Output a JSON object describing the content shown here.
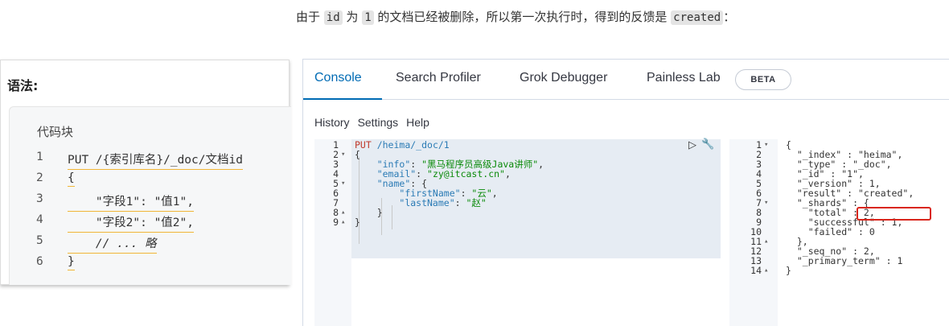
{
  "top_text": {
    "part1": "由于 ",
    "code1": "id",
    "part2": " 为 ",
    "code2": "1",
    "part3": " 的文档已经被删除，所以第一次执行时，得到的反馈是 ",
    "code3": "created",
    "part4": "："
  },
  "syntax": {
    "title": "语法:",
    "block_title": "代码块",
    "lines": [
      {
        "no": "1",
        "text": "PUT /{索引库名}/_doc/文档id"
      },
      {
        "no": "2",
        "text": "{"
      },
      {
        "no": "3",
        "text": "    \"字段1\": \"值1\","
      },
      {
        "no": "4",
        "text": "    \"字段2\": \"值2\","
      },
      {
        "no": "5",
        "text": "    // ... 略"
      },
      {
        "no": "6",
        "text": "}"
      }
    ]
  },
  "console": {
    "tabs": [
      "Console",
      "Search Profiler",
      "Grok Debugger",
      "Painless Lab"
    ],
    "active_tab": "Console",
    "beta_label": "BETA",
    "toolbar": [
      "History",
      "Settings",
      "Help"
    ],
    "request": {
      "method": "PUT",
      "path": " /heima/_doc/1",
      "line_numbers": [
        "1",
        "2",
        "3",
        "4",
        "5",
        "6",
        "7",
        "8",
        "9"
      ],
      "info_key": "\"info\"",
      "info_val": "\"黑马程序员高级Java讲师\"",
      "email_key": "\"email\"",
      "email_val": "\"zy@itcast.cn\"",
      "name_key": "\"name\"",
      "first_key": "\"firstName\"",
      "first_val": "\"云\"",
      "last_key": "\"lastName\"",
      "last_val": "\"赵\""
    },
    "response": {
      "line_numbers": [
        "1",
        "2",
        "3",
        "4",
        "5",
        "6",
        "7",
        "8",
        "9",
        "10",
        "11",
        "12",
        "13",
        "14"
      ],
      "lines": [
        "{",
        "  \"_index\" : \"heima\",",
        "  \"_type\" : \"_doc\",",
        "  \"_id\" : \"1\",",
        "  \"_version\" : 1,",
        "  \"result\" : \"created\",",
        "  \"_shards\" : {",
        "    \"total\" : 2,",
        "    \"successful\" : 1,",
        "    \"failed\" : 0",
        "  },",
        "  \"_seq_no\" : 2,",
        "  \"_primary_term\" : 1",
        "}"
      ]
    },
    "colors": {
      "accent": "#006bb4",
      "highlight_box": "#d9261c",
      "string": "#0a8a0a",
      "key": "#2b7bb5"
    }
  }
}
